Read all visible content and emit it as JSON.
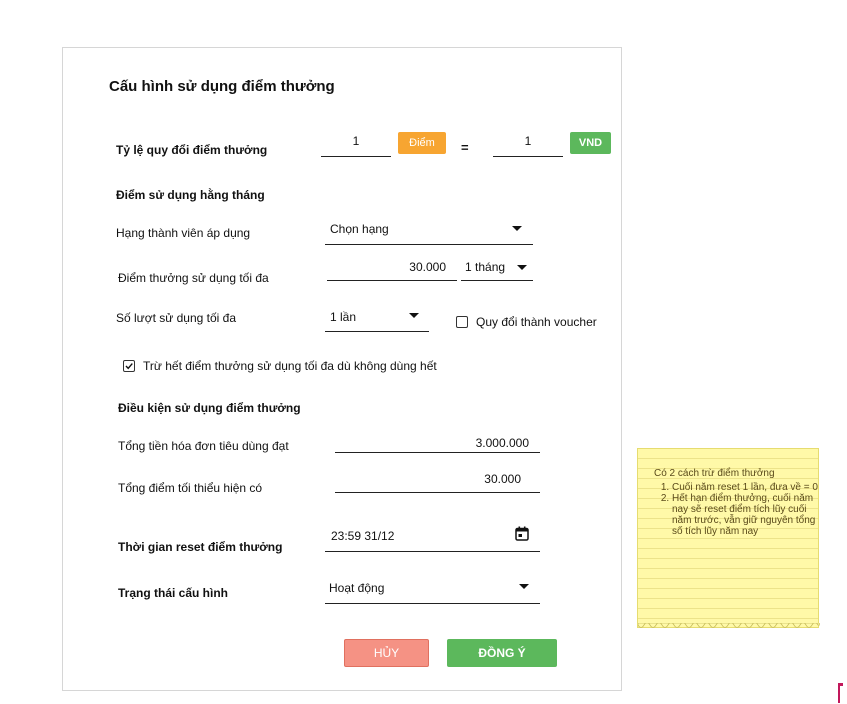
{
  "form": {
    "title": "Cấu hình sử dụng điểm thưởng",
    "exchange": {
      "label": "Tỷ lệ quy đổi điểm thưởng",
      "points_value": "1",
      "points_badge": "Điểm",
      "equals": "=",
      "vnd_value": "1",
      "vnd_badge": "VND"
    },
    "monthly": {
      "heading": "Điểm sử dụng hằng tháng",
      "tier_label": "Hạng thành viên áp dụng",
      "tier_value": "Chọn hạng",
      "max_points_label": "Điểm thưởng sử dụng tối đa",
      "max_points_value": "30.000",
      "period_value": "1 tháng",
      "max_uses_label": "Số lượt sử dụng tối đa",
      "max_uses_value": "1 lần",
      "voucher_label": "Quy đổi thành voucher",
      "voucher_checked": false,
      "deduct_label": "Trừ hết điểm thưởng sử dụng tối đa dù không dùng hết",
      "deduct_checked": true
    },
    "conditions": {
      "heading": "Điều kiện sử dụng điểm thưởng",
      "invoice_label": "Tổng tiền hóa đơn tiêu dùng đạt",
      "invoice_value": "3.000.000",
      "min_points_label": "Tổng điểm tối thiểu hiện có",
      "min_points_value": "30.000"
    },
    "reset": {
      "label": "Thời gian reset điểm thưởng",
      "value": "23:59 31/12"
    },
    "status": {
      "label": "Trạng thái cấu hình",
      "value": "Hoạt động"
    },
    "buttons": {
      "cancel": "HỦY",
      "confirm": "ĐỒNG Ý"
    }
  },
  "note": {
    "title": "Có 2 cách trừ điểm thưởng",
    "items": [
      "Cuối năm reset 1 lần, đưa về = 0",
      "Hết hạn điểm thưởng, cuối năm nay sẽ reset điểm tích lũy cuối năm trước, vẫn giữ nguyên tổng số tích lũy năm nay"
    ]
  },
  "colors": {
    "orange": "#f7a531",
    "green": "#5cb85c",
    "cancel_bg": "#f59284",
    "note_bg": "#fff9a8",
    "marker": "#c2185b"
  }
}
